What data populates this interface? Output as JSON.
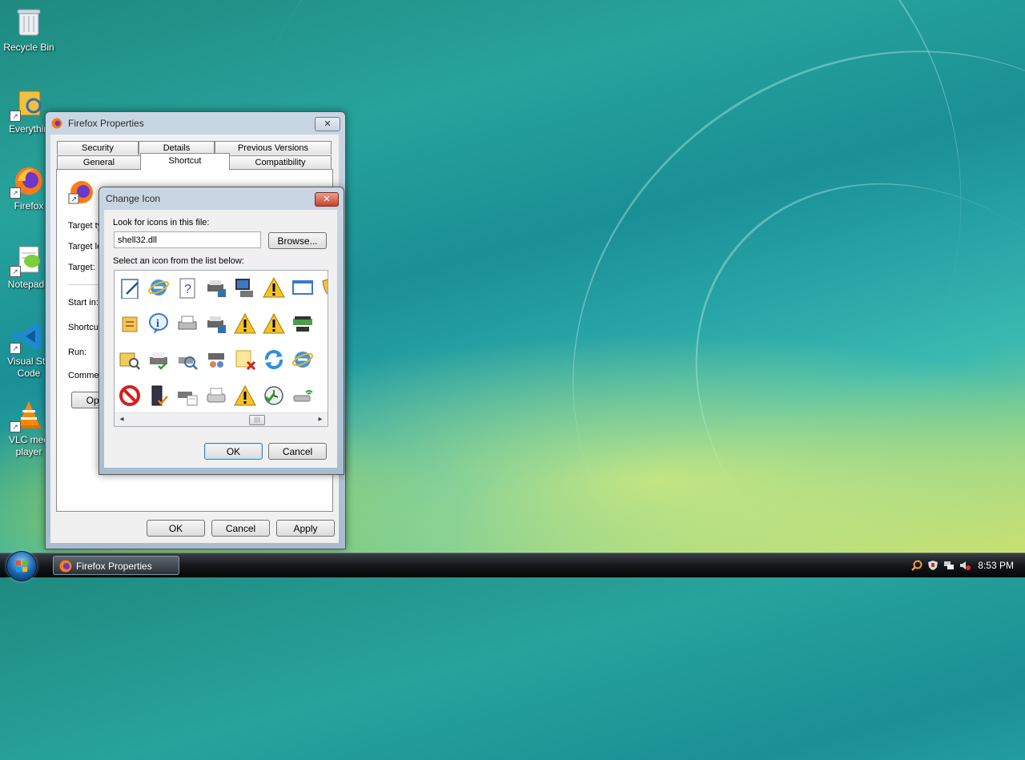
{
  "desktop": {
    "icons": [
      {
        "label": "Recycle Bin",
        "icon": "recycle-bin-icon"
      },
      {
        "label": "Everythin",
        "icon": "everything-search-icon"
      },
      {
        "label": "Firefox",
        "icon": "firefox-icon"
      },
      {
        "label": "Notepad+",
        "icon": "notepad-plus-plus-icon"
      },
      {
        "label": "Visual Stu",
        "label2": "Code",
        "icon": "vscode-icon"
      },
      {
        "label": "VLC med",
        "label2": "player",
        "icon": "vlc-icon"
      }
    ]
  },
  "properties_window": {
    "title": "Firefox Properties",
    "tabs_row1": [
      "Security",
      "Details",
      "Previous Versions"
    ],
    "tabs_row2": [
      "General",
      "Shortcut",
      "Compatibility"
    ],
    "active_tab": "Shortcut",
    "fields": [
      "Target ty",
      "Target lo",
      "Target:",
      "Start in:",
      "Shortcut",
      "Run:",
      "Commen"
    ],
    "open_button": "Ope",
    "buttons": {
      "ok": "OK",
      "cancel": "Cancel",
      "apply": "Apply"
    },
    "close": "✕"
  },
  "change_icon_dialog": {
    "title": "Change Icon",
    "look_label": "Look for icons in this file:",
    "file_value": "shell32.dll",
    "browse": "Browse...",
    "select_label": "Select an icon from the list below:",
    "ok": "OK",
    "cancel": "Cancel",
    "close": "✕",
    "scroll_left": "◂",
    "scroll_right": "▸",
    "scroll_thumb": "|||",
    "icons": [
      "edit-document-icon",
      "internet-explorer-icon",
      "help-document-icon",
      "network-printer-icon",
      "computer-monitor-icon",
      "warning-icon",
      "window-icon",
      "shield-icon",
      "stacked-list-icon",
      "information-icon",
      "printer-icon",
      "network-printer-icon",
      "warning-icon",
      "warning-icon",
      "network-hardware-icon",
      "partial-icon",
      "folder-search-icon",
      "printer-check-icon",
      "search-printer-icon",
      "network-users-icon",
      "folder-delete-icon",
      "refresh-icon",
      "internet-explorer-icon",
      "partial-icon",
      "blocked-icon",
      "server-check-icon",
      "printer-document-icon",
      "fax-icon",
      "warning-icon",
      "clock-check-icon",
      "wireless-usb-icon",
      "partial-icon"
    ]
  },
  "taskbar": {
    "task_button": "Firefox Properties",
    "clock": "8:53 PM"
  }
}
